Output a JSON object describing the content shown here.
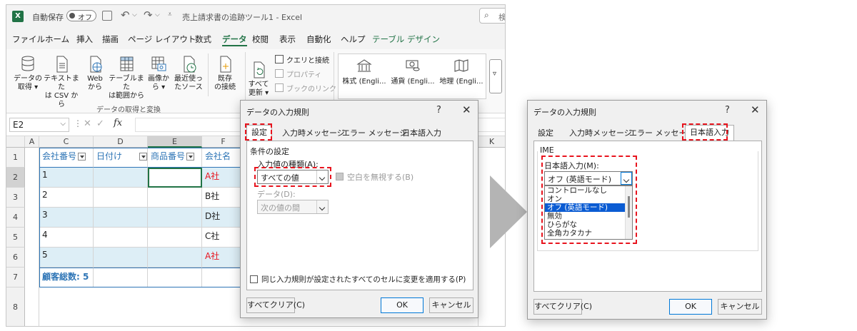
{
  "titlebar": {
    "autosave": "自動保存",
    "toggle": "オフ",
    "doc_title": "売上請求書の追跡ツール1 - Excel",
    "search_partial": "検"
  },
  "menu": [
    "ファイル",
    "ホーム",
    "挿入",
    "描画",
    "ページ レイアウト",
    "数式",
    "データ",
    "校閲",
    "表示",
    "自動化",
    "ヘルプ",
    "テーブル デザイン"
  ],
  "ribbon": {
    "get_data": [
      "データの",
      "取得 ▾"
    ],
    "from_text": [
      "テキストまた",
      "は CSV から"
    ],
    "from_web": [
      "Web",
      "から"
    ],
    "from_table": [
      "テーブルまた",
      "は範囲から"
    ],
    "from_picture": [
      "画像か",
      "ら ▾"
    ],
    "recent": [
      "最近使っ",
      "たソース"
    ],
    "existing": [
      "既存",
      "の接続"
    ],
    "group_label": "データの取得と変換",
    "refresh": [
      "すべて",
      "更新 ▾"
    ],
    "queries": "クエリと接続",
    "properties": "プロパティ",
    "links": "ブックのリンク",
    "stocks": "株式 (Engli...",
    "currency": "通貨 (Engli...",
    "geography": "地理 (Engli..."
  },
  "formula_bar": {
    "name_box": "E2",
    "fx": "fx"
  },
  "grid": {
    "columns": [
      "A",
      "C",
      "D",
      "E",
      "F",
      "K"
    ],
    "rows": [
      "1",
      "2",
      "3",
      "4",
      "5",
      "6",
      "7",
      "8"
    ],
    "headers": [
      "会社番号",
      "日付け",
      "商品番号",
      "会社名"
    ],
    "data": [
      {
        "num": "1",
        "company": "A社"
      },
      {
        "num": "2",
        "company": "B社"
      },
      {
        "num": "3",
        "company": "D社"
      },
      {
        "num": "4",
        "company": "C社"
      },
      {
        "num": "5",
        "company": "A社"
      }
    ],
    "total": "顧客総数: 5"
  },
  "dialog1": {
    "title": "データの入力規則",
    "q": "?",
    "x": "✕",
    "tabs": [
      "設定",
      "入力時メッセージ",
      "エラー メッセージ",
      "日本語入力"
    ],
    "section": "条件の設定",
    "type_label": "入力値の種類(A):",
    "type_value": "すべての値",
    "ignore_blank": "空白を無視する(B)",
    "data_label": "データ(D):",
    "data_value": "次の値の間",
    "apply_all": "同じ入力規則が設定されたすべてのセルに変更を適用する(P)",
    "clear_all": "すべてクリア(C)",
    "ok": "OK",
    "cancel": "キャンセル"
  },
  "dialog2": {
    "title": "データの入力規則",
    "q": "?",
    "x": "✕",
    "tabs": [
      "設定",
      "入力時メッセージ",
      "エラー メッセージ",
      "日本語入力"
    ],
    "group": "IME",
    "ime_label": "日本語入力(M):",
    "ime_value": "オフ (英語モード)",
    "options": [
      "コントロールなし",
      "オン",
      "オフ (英語モード)",
      "無効",
      "ひらがな",
      "全角カタカナ"
    ],
    "selected_index": 2,
    "clear_all": "すべてクリア(C)",
    "ok": "OK",
    "cancel": "キャンセル"
  },
  "colors": {
    "excel_green": "#217346",
    "header_blue": "#2e75b6",
    "red_text": "#e8141e",
    "band": "#ddeef6"
  }
}
